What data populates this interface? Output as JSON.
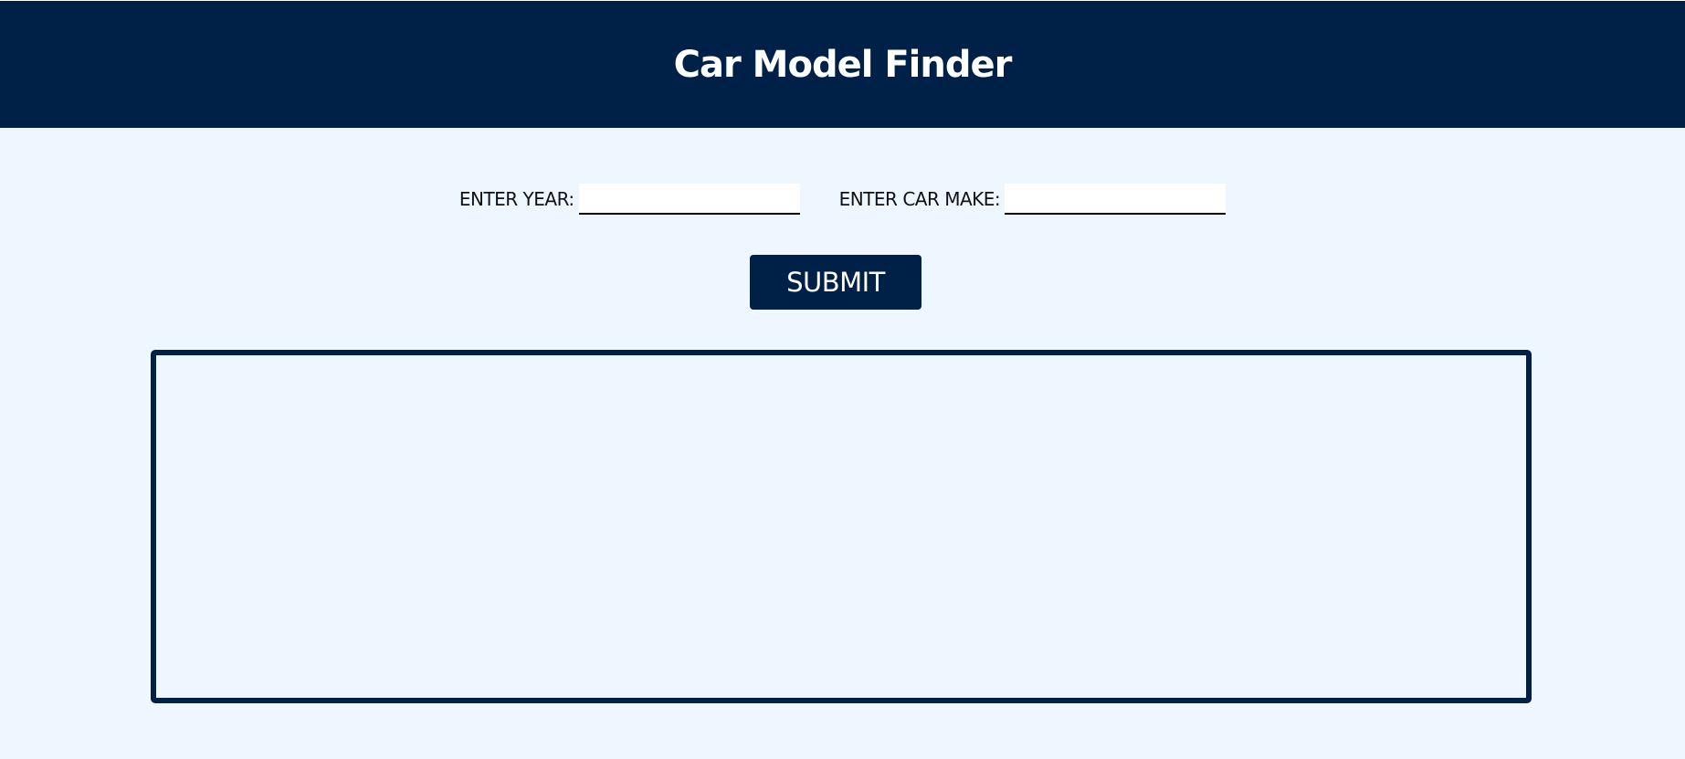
{
  "header": {
    "title": "Car Model Finder"
  },
  "form": {
    "year_label": "ENTER YEAR:",
    "year_value": "",
    "make_label": "ENTER CAR MAKE:",
    "make_value": "",
    "submit_label": "SUBMIT"
  },
  "results": {
    "content": ""
  },
  "colors": {
    "primary": "#002147",
    "background": "#EEF6FF",
    "input_background": "#FFFFFF"
  }
}
